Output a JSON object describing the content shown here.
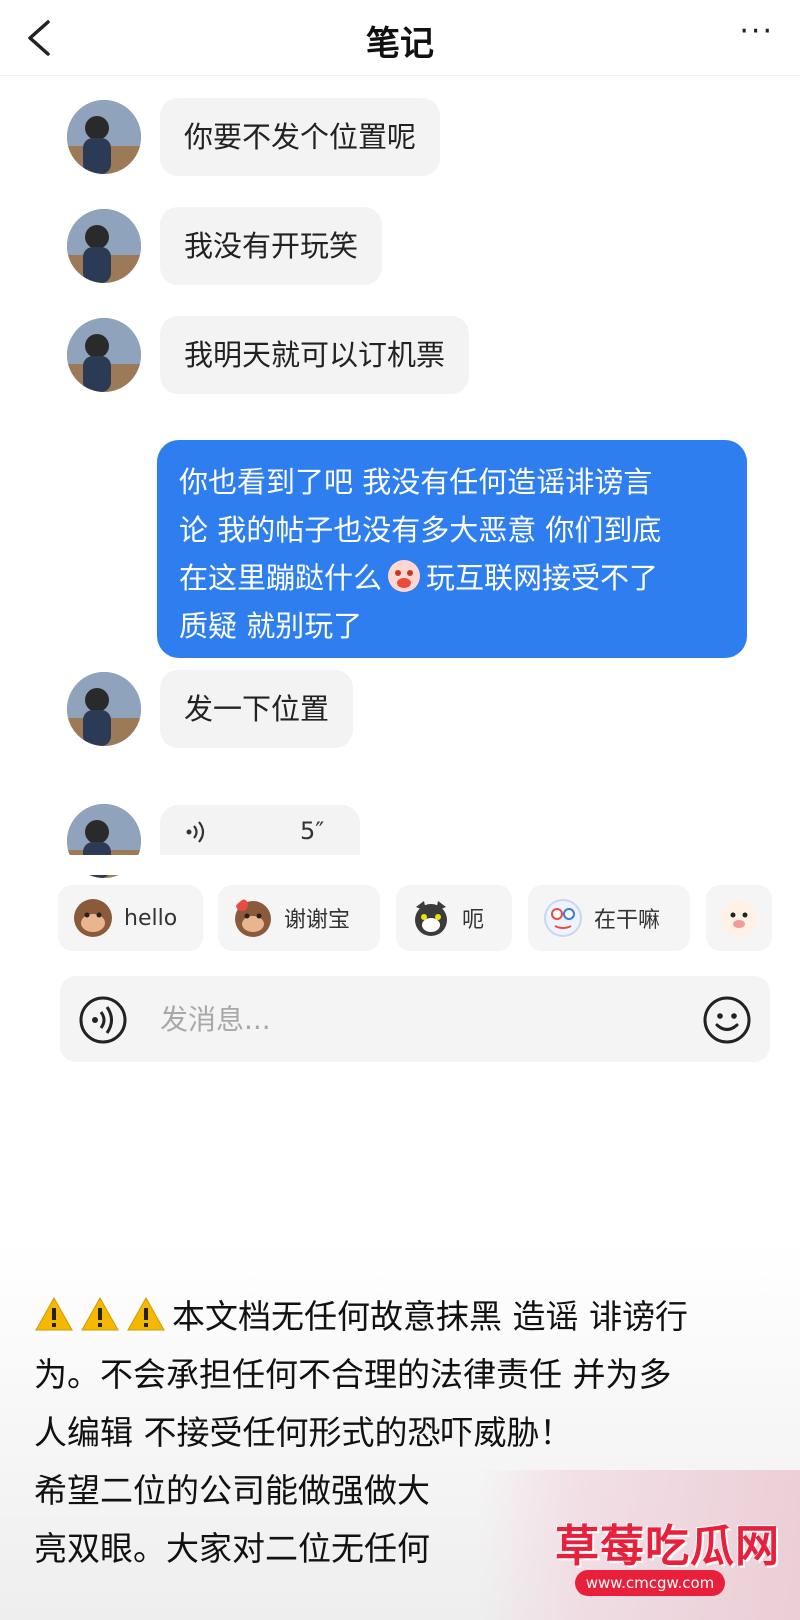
{
  "header": {
    "title": "笔记",
    "back_icon": "chevron-left-icon",
    "more_label": "···"
  },
  "messages": [
    {
      "side": "in",
      "text": "你要不发个位置呢"
    },
    {
      "side": "in",
      "text": "我没有开玩笑"
    },
    {
      "side": "in",
      "text": "我明天就可以订机票"
    },
    {
      "side": "out",
      "lines": [
        "你也看到了吧 我没有任何造谣诽谤言",
        "论 我的帖子也没有多大恶意 你们到底",
        "在这里蹦跶什么",
        "玩互联网接受不了",
        "质疑 就别玩了"
      ]
    },
    {
      "side": "in",
      "text": "发一下位置"
    },
    {
      "side": "in",
      "type": "voice",
      "duration": "5″"
    }
  ],
  "quick_replies": [
    {
      "label": "hello",
      "icon": "monkey-sticker-icon"
    },
    {
      "label": "谢谢宝",
      "icon": "monkey-flower-sticker-icon"
    },
    {
      "label": "呃",
      "icon": "cat-sticker-icon"
    },
    {
      "label": "在干嘛",
      "icon": "doodle-sticker-icon"
    }
  ],
  "input": {
    "placeholder": "发消息..."
  },
  "notice": {
    "lines": [
      "本文档无任何故意抹黑 造谣 诽谤行",
      "为。不会承担任何不合理的法律责任 并为多",
      "人编辑 不接受任何形式的恐吓威胁！",
      "希望二位的公司能做强做大",
      "亮双眼。大家对二位无任何"
    ]
  },
  "watermark": {
    "brand": "草莓吃瓜网",
    "url": "www.cmcgw.com"
  },
  "colors": {
    "accent": "#2f7ef0",
    "bubble_in": "#f3f3f3",
    "warning": "#f5b800",
    "watermark": "#e8203c"
  }
}
